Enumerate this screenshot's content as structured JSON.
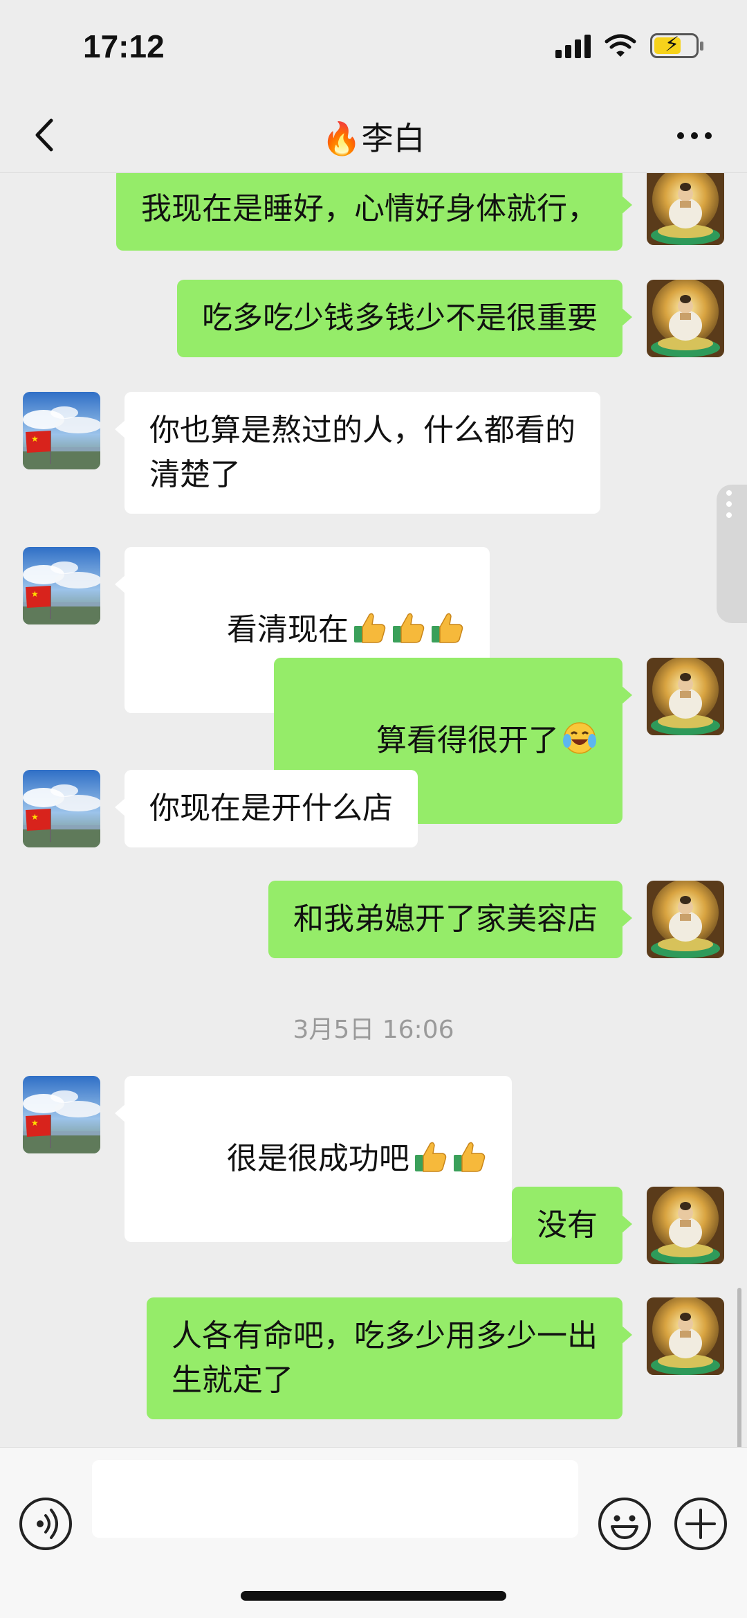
{
  "status_bar": {
    "time": "17:12"
  },
  "nav": {
    "title": "🔥李白"
  },
  "messages": [
    {
      "side": "right",
      "text": "我现在是睡好，心情好身体就行，"
    },
    {
      "side": "right",
      "text": "吃多吃少钱多钱少不是很重要"
    },
    {
      "side": "left",
      "text": "你也算是熬过的人，什么都看的\n清楚了"
    },
    {
      "side": "left",
      "text": "看清现在",
      "emoji": [
        "thumbs-up",
        "thumbs-up",
        "thumbs-up"
      ]
    },
    {
      "side": "right",
      "text": "算看得很开了",
      "emoji": [
        "crying-laughing"
      ]
    },
    {
      "side": "left",
      "text": "你现在是开什么店"
    },
    {
      "side": "right",
      "text": "和我弟媳开了家美容店"
    },
    {
      "side": "left",
      "text": "很是很成功吧",
      "emoji": [
        "thumbs-up",
        "thumbs-up"
      ]
    },
    {
      "side": "right",
      "text": "没有"
    },
    {
      "side": "right",
      "text": "人各有命吧，吃多少用多少一出\n生就定了"
    }
  ],
  "timestamp": "3月5日 16:06",
  "input": {
    "value": ""
  },
  "colors": {
    "background": "#ededed",
    "outgoing_bubble": "#95ec69",
    "incoming_bubble": "#ffffff",
    "timestamp_text": "#9a9a9a"
  },
  "icons": {
    "back": "chevron-left-icon",
    "more": "more-dots-icon",
    "voice": "voice-input-icon",
    "emoji": "emoji-icon",
    "plus": "plus-icon",
    "contact_avatar": "flag-avatar",
    "my_avatar": "buddha-avatar"
  }
}
